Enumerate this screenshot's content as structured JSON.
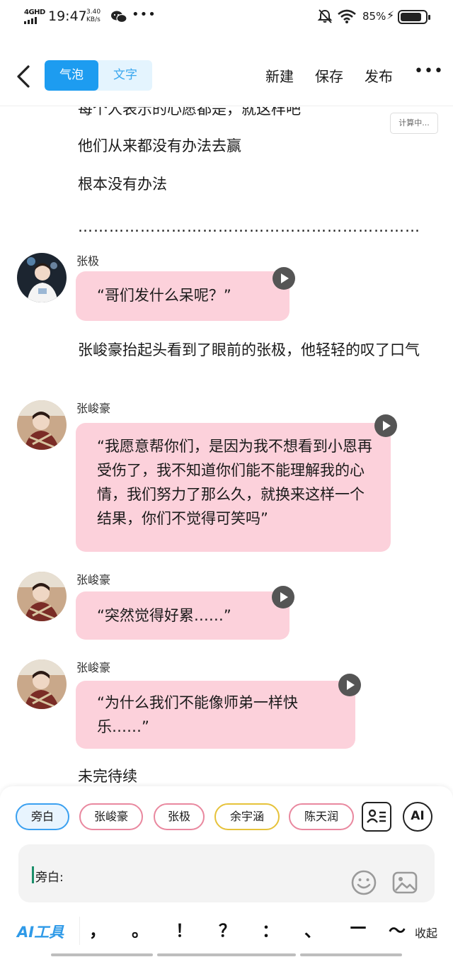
{
  "status_bar": {
    "network": "4GHD",
    "time": "19:47",
    "speed_value": "3.40",
    "speed_unit": "KB/s",
    "more": "•••",
    "battery_percent": "85%",
    "battery_level": 0.85
  },
  "header": {
    "tabs": [
      {
        "label": "气泡",
        "active": true
      },
      {
        "label": "文字",
        "active": false
      }
    ],
    "actions": {
      "new": "新建",
      "save": "保存",
      "publish": "发布",
      "more": "•••"
    }
  },
  "content": {
    "calc_badge": "计算中...",
    "lines": {
      "cut": "每个人表示的心愿都是，就这样吧",
      "l1": "他们从来都没有办法去赢",
      "l2": "根本没有办法",
      "l3": "…………………………………………………………",
      "l4": "张峻豪抬起头看到了眼前的张极，他轻轻的叹了口气",
      "l5": "未完待续"
    },
    "messages": [
      {
        "speaker": "张极",
        "text": "“哥们发什么呆呢？”"
      },
      {
        "speaker": "张峻豪",
        "text": "“我愿意帮你们，是因为我不想看到小恩再受伤了，我不知道你们能不能理解我的心情，我们努力了那么久，就换来这样一个结果，你们不觉得可笑吗”"
      },
      {
        "speaker": "张峻豪",
        "text": "“突然觉得好累……”"
      },
      {
        "speaker": "张峻豪",
        "text": "“为什么我们不能像师弟一样快乐……”"
      }
    ]
  },
  "bottom": {
    "chips": [
      "旁白",
      "张峻豪",
      "张极",
      "余宇涵",
      "陈天润"
    ],
    "ai_button": "AI",
    "input_prefix": "旁白:",
    "ai_tools": "AI工具",
    "punctuation": [
      "，",
      "。",
      "！",
      "？",
      "：",
      "、",
      "—",
      "～"
    ],
    "collapse": "收起"
  },
  "colors": {
    "accent": "#1d9cf0",
    "bubble_pink": "#fcd1db",
    "chip_pink": "#e9889f",
    "chip_yellow": "#e6c23a"
  }
}
